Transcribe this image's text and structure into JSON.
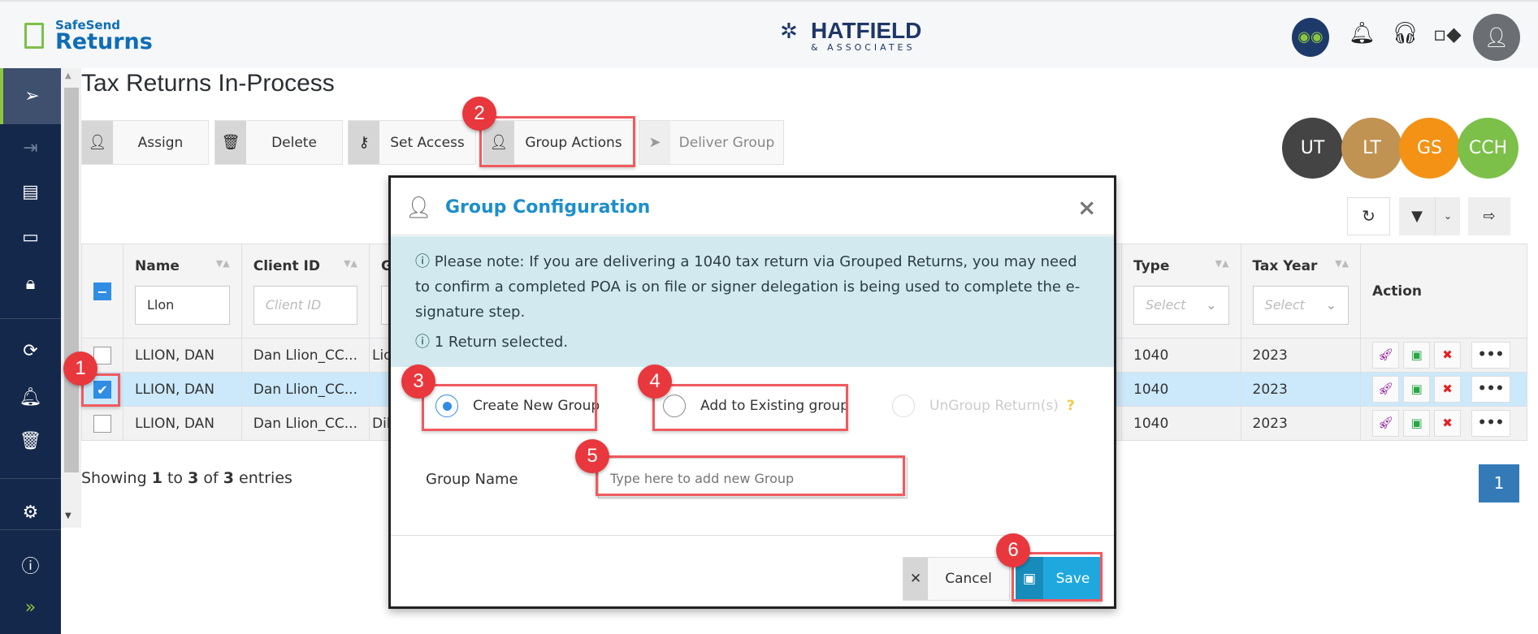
{
  "header": {
    "logo_top": "SafeSend",
    "logo_bottom": "Returns",
    "firm_name": "HATFIELD",
    "firm_sub": "& ASSOCIATES"
  },
  "sidebar": {
    "items": [
      "send-icon",
      "import-icon",
      "document-icon",
      "archive-icon",
      "lock-icon",
      "users-icon",
      "bell-icon",
      "trash-icon",
      "gear-icon",
      "help-icon",
      "expand-icon"
    ]
  },
  "page": {
    "title": "Tax Returns In-Process"
  },
  "toolbar": {
    "assign": "Assign",
    "delete": "Delete",
    "set_access": "Set Access",
    "group_actions": "Group Actions",
    "deliver_group": "Deliver Group"
  },
  "software": [
    {
      "label": "UT",
      "color": "#444444"
    },
    {
      "label": "LT",
      "color": "#c09352"
    },
    {
      "label": "GS",
      "color": "#f39214"
    },
    {
      "label": "CCH",
      "color": "#7cc04a"
    }
  ],
  "table": {
    "columns": {
      "name": "Name",
      "client_id": "Client ID",
      "group": "Gro",
      "type": "Type",
      "tax_year": "Tax Year",
      "action": "Action"
    },
    "filters": {
      "name": "Llon",
      "client_id": "Client ID",
      "type": "Select",
      "tax_year": "Select"
    },
    "rows": [
      {
        "name": "LLION, DAN",
        "client_id": "Dan Llion_CC...",
        "group": "Lio",
        "type": "1040",
        "tax_year": "2023",
        "checked": false
      },
      {
        "name": "LLION, DAN",
        "client_id": "Dan Llion_CC...",
        "group": "",
        "type": "1040",
        "tax_year": "2023",
        "checked": true
      },
      {
        "name": "LLION, DAN",
        "client_id": "Dan Llion_CC...",
        "group": "Dil",
        "type": "1040",
        "tax_year": "2023",
        "checked": false
      }
    ],
    "more": "•••"
  },
  "footer": {
    "showing": "Showing",
    "from": "1",
    "to_word": "to",
    "to": "3",
    "of_word": "of",
    "total": "3",
    "entries": "entries",
    "page": "1"
  },
  "modal": {
    "title": "Group Configuration",
    "note": "Please note: If you are delivering a 1040 tax return via Grouped Returns, you may need to confirm a completed POA is on file or signer delegation is being used to complete the e-signature step.",
    "selected": "1 Return selected.",
    "options": {
      "create": "Create New Group",
      "add": "Add to Existing group",
      "ungroup": "UnGroup Return(s)"
    },
    "selected_option": "create",
    "group_name_label": "Group Name",
    "group_name_placeholder": "Type here to add new Group",
    "cancel": "Cancel",
    "save": "Save"
  },
  "steps": [
    "1",
    "2",
    "3",
    "4",
    "5",
    "6"
  ]
}
